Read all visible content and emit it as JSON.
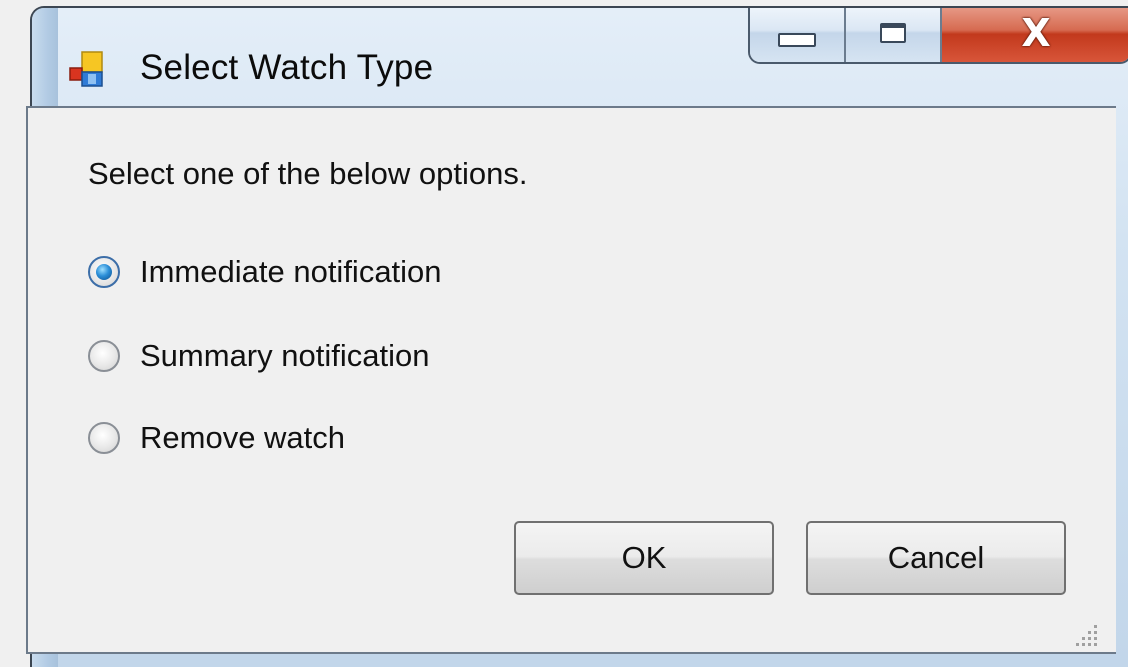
{
  "window": {
    "title": "Select Watch Type",
    "icon": "app-window-icon"
  },
  "caption_buttons": {
    "minimize_icon": "minimize-icon",
    "maximize_icon": "maximize-icon",
    "close_icon": "close-icon",
    "close_glyph": "X"
  },
  "dialog": {
    "prompt": "Select one of the below options.",
    "options": [
      {
        "label": "Immediate notification",
        "selected": true
      },
      {
        "label": "Summary notification",
        "selected": false
      },
      {
        "label": "Remove watch",
        "selected": false
      }
    ],
    "ok_label": "OK",
    "cancel_label": "Cancel"
  },
  "colors": {
    "close_button": "#c2391c",
    "radio_selected": "#2c8fd8"
  }
}
